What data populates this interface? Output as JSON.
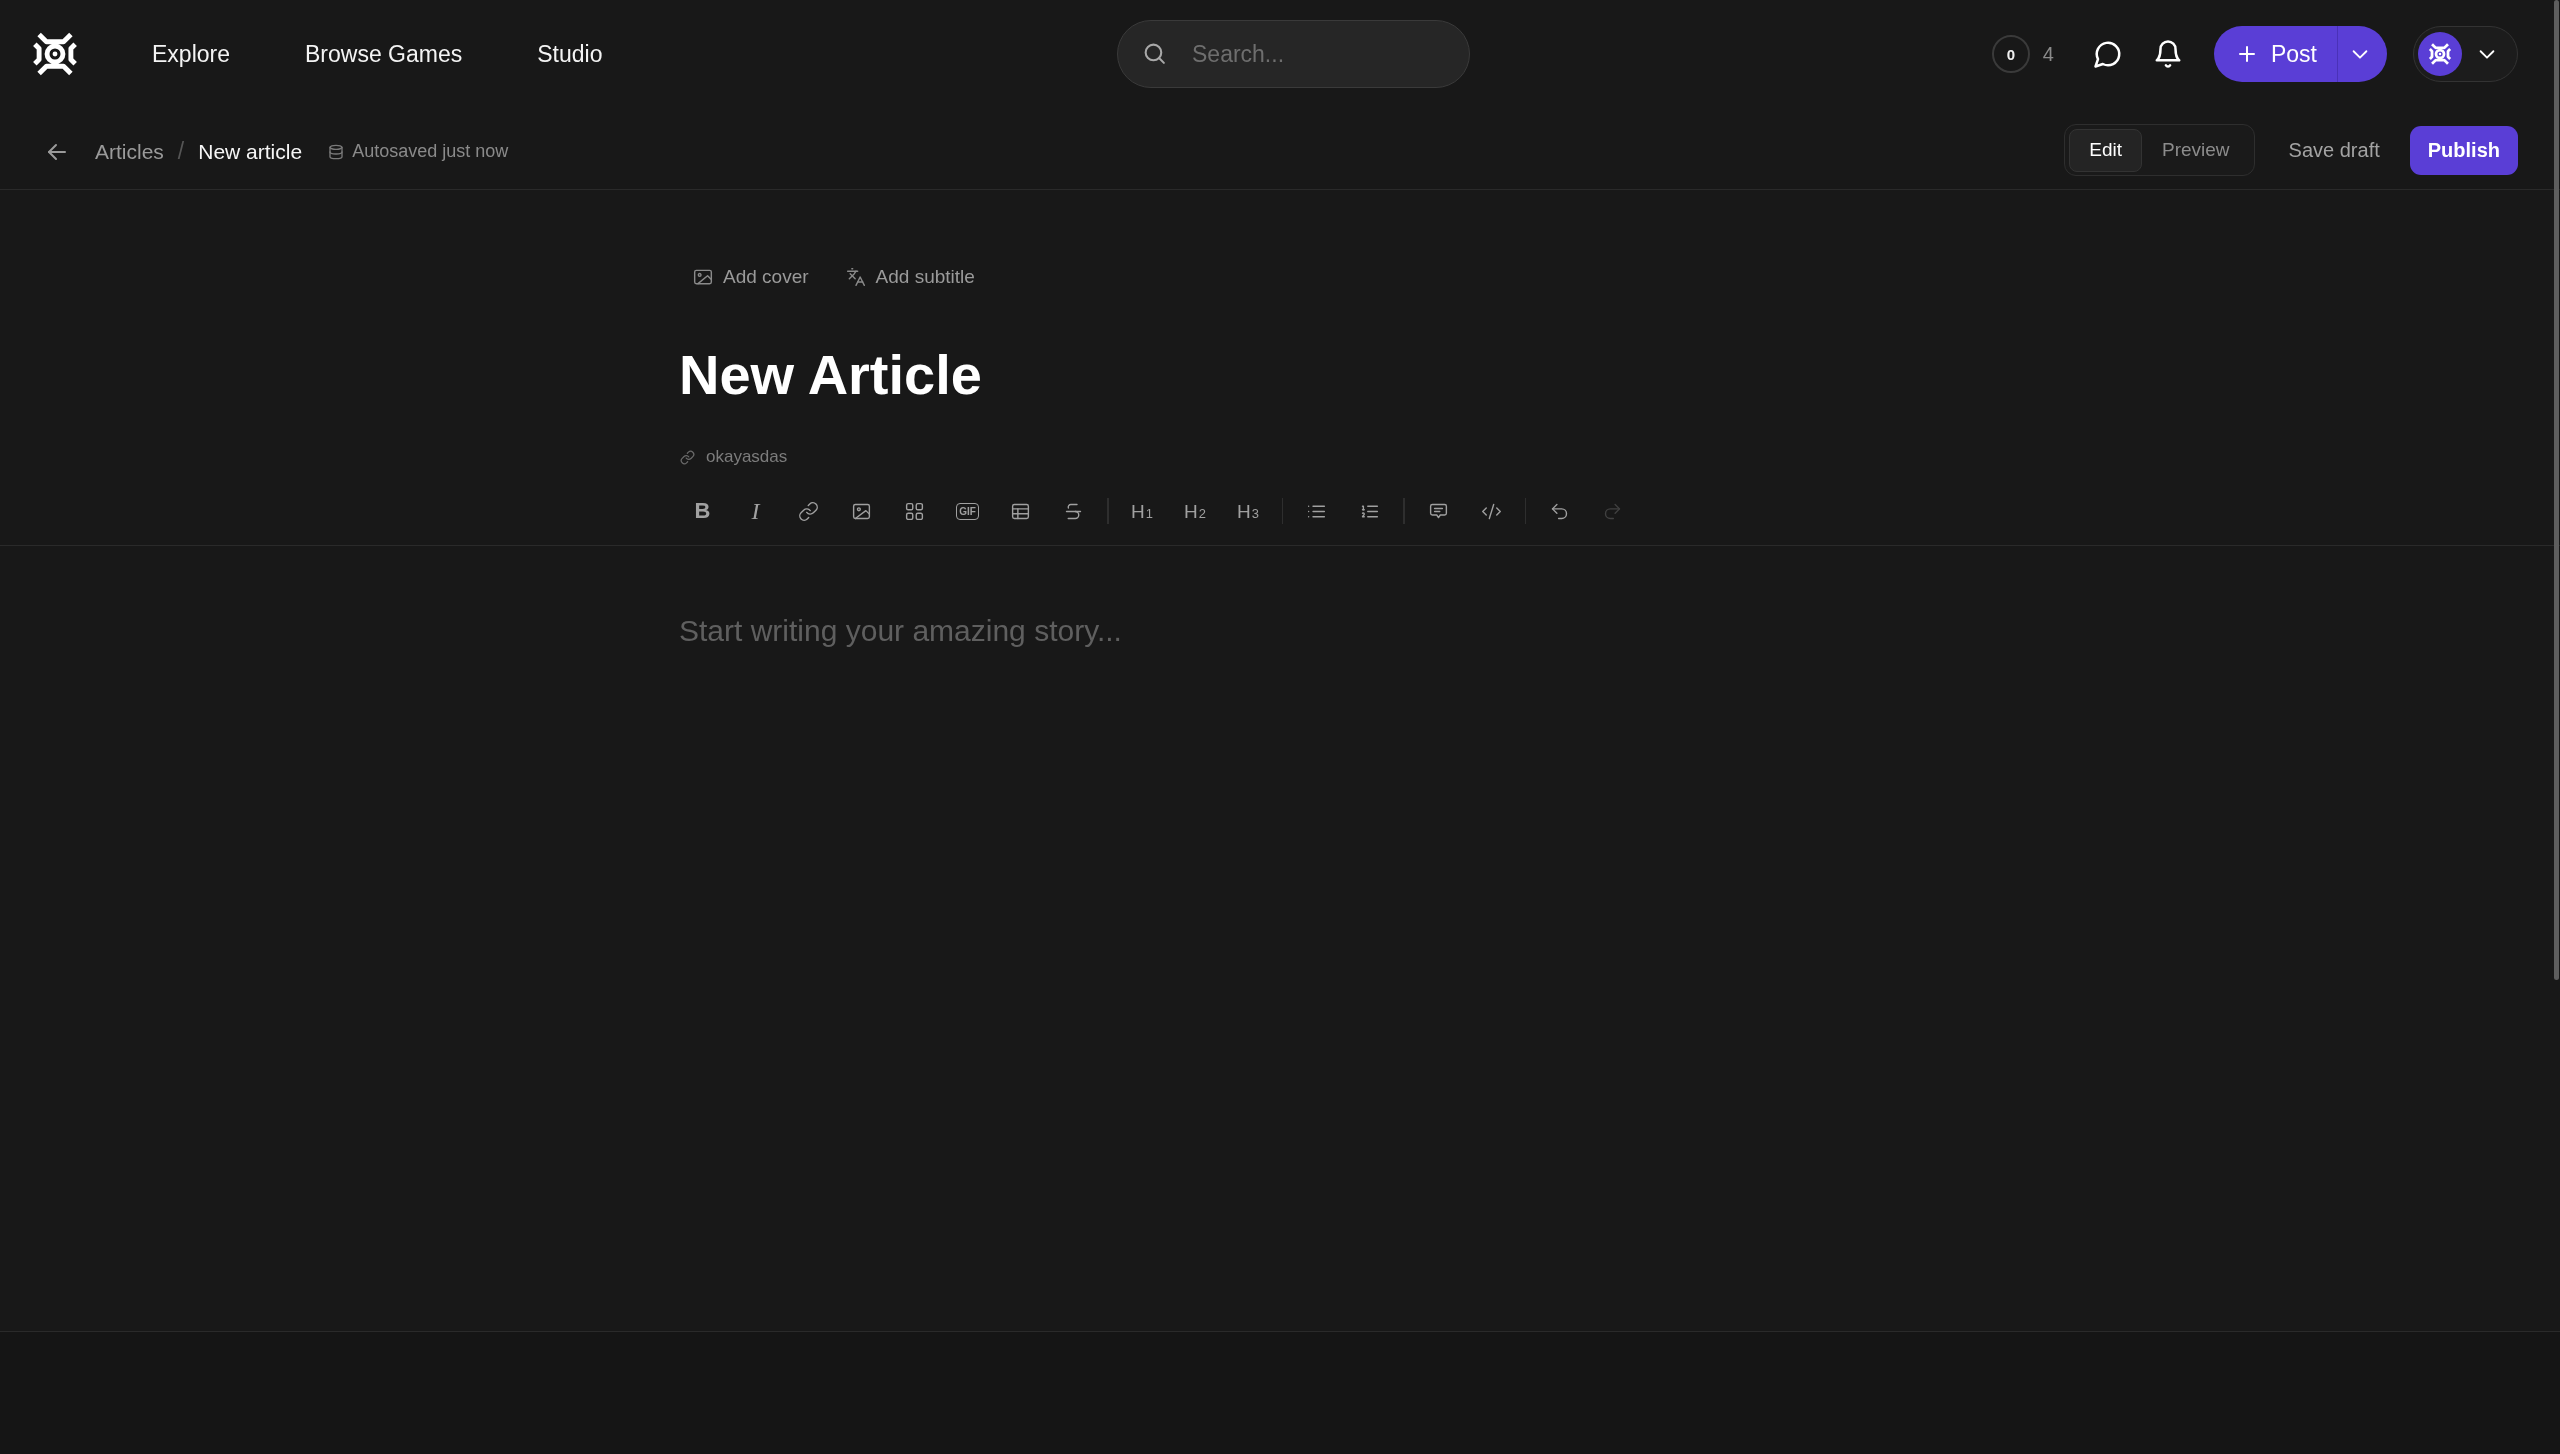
{
  "header": {
    "nav": [
      {
        "label": "Explore"
      },
      {
        "label": "Browse Games"
      },
      {
        "label": "Studio"
      }
    ],
    "search": {
      "placeholder": "Search..."
    },
    "counter": {
      "ring": "0",
      "count": "4"
    },
    "post_button": {
      "label": "Post"
    }
  },
  "breadcrumb": {
    "items": [
      {
        "label": "Articles",
        "current": false
      },
      {
        "label": "New article",
        "current": true
      }
    ],
    "separator": "/",
    "autosave": "Autosaved just now"
  },
  "mode_tabs": [
    {
      "label": "Edit",
      "selected": true
    },
    {
      "label": "Preview",
      "selected": false
    }
  ],
  "actions": {
    "save_draft": "Save draft",
    "publish": "Publish"
  },
  "editor": {
    "add_cover": "Add cover",
    "add_subtitle": "Add subtitle",
    "title": "New Article",
    "slug": "okayasdas",
    "toolbar": [
      [
        {
          "kind": "bold",
          "label": "B",
          "disabled": false
        },
        {
          "kind": "italic",
          "label": "I",
          "disabled": false
        },
        {
          "kind": "link",
          "disabled": false
        },
        {
          "kind": "image",
          "disabled": false
        },
        {
          "kind": "gallery",
          "disabled": false
        },
        {
          "kind": "gif",
          "label": "GIF",
          "disabled": false
        },
        {
          "kind": "table",
          "disabled": false
        },
        {
          "kind": "strike",
          "disabled": false
        }
      ],
      [
        {
          "kind": "heading",
          "label": "H$_{1}$",
          "disabled": false
        },
        {
          "kind": "heading",
          "label": "H$_{2}$",
          "disabled": false
        },
        {
          "kind": "heading",
          "label": "H$_{3}$",
          "disabled": false
        }
      ],
      [
        {
          "kind": "bullets",
          "disabled": false
        },
        {
          "kind": "numbered",
          "disabled": false
        }
      ],
      [
        {
          "kind": "comment",
          "disabled": false
        },
        {
          "kind": "code",
          "disabled": false
        }
      ],
      [
        {
          "kind": "undo",
          "disabled": false
        },
        {
          "kind": "redo",
          "disabled": true
        }
      ]
    ],
    "body": {
      "placeholder": "Start writing your amazing story..."
    }
  }
}
